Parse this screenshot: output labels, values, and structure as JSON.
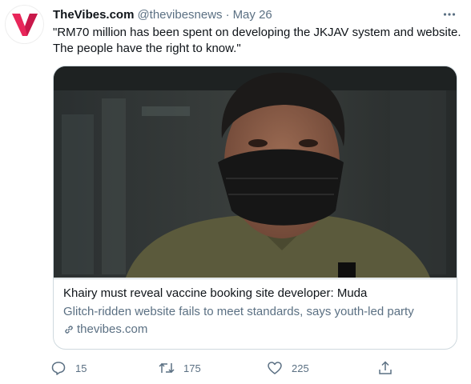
{
  "tweet": {
    "author_name": "TheVibes.com",
    "author_handle": "@thevibesnews",
    "separator": "·",
    "date": "May 26",
    "text_line1": "\"RM70 million has been spent on developing the JKJAV system and website.",
    "text_line2": "The people have the right to know.\""
  },
  "card": {
    "title": "Khairy must reveal vaccine booking site developer: Muda",
    "description": "Glitch-ridden website fails to meet standards, says youth-led party",
    "domain": "thevibes.com"
  },
  "actions": {
    "reply_count": "15",
    "retweet_count": "175",
    "like_count": "225"
  },
  "icons": {
    "avatar": "vibes-v-logo",
    "more": "more-icon",
    "reply": "reply-icon",
    "retweet": "retweet-icon",
    "like": "heart-icon",
    "share": "share-icon",
    "link": "link-icon"
  },
  "colors": {
    "brand": "#e8265a",
    "text": "#0f1419",
    "muted": "#5b7083",
    "border": "#cfd9de"
  }
}
